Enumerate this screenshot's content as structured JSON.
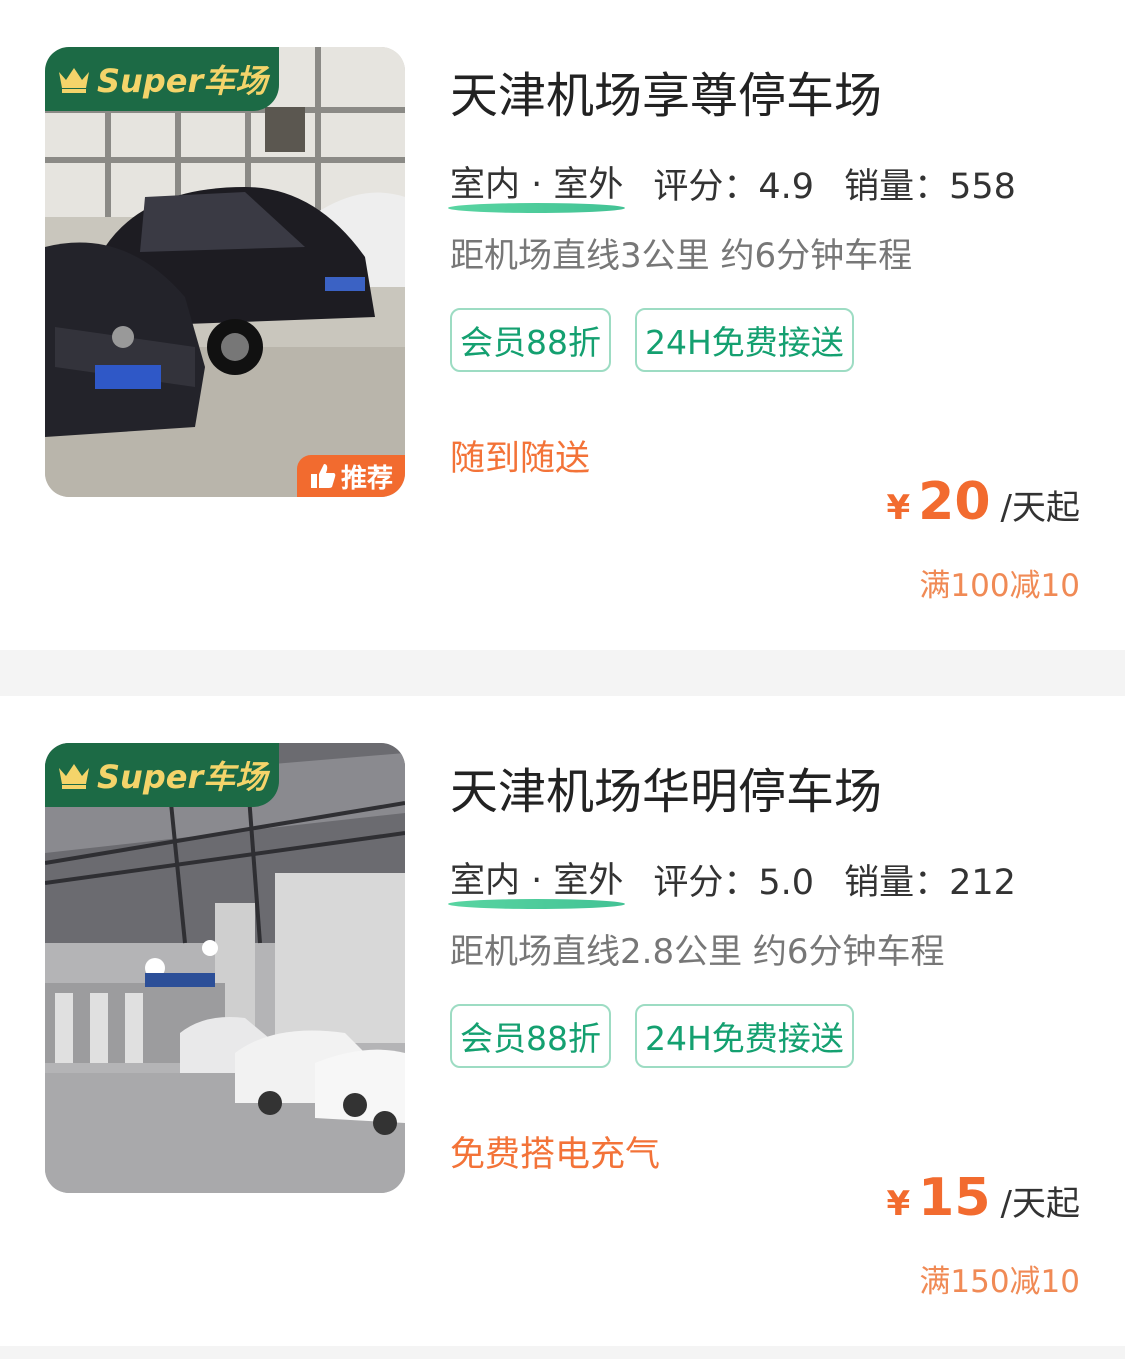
{
  "lots": [
    {
      "super_badge": "Super车场",
      "recommend_badge": "推荐",
      "name": "天津机场享尊停车场",
      "environment": "室内 · 室外",
      "rating": "评分：4.9",
      "sales": "销量：558",
      "distance": "距机场直线3公里 约6分钟车程",
      "tags": [
        "会员88折",
        "24H免费接送"
      ],
      "service": "随到随送",
      "currency": "¥",
      "price": "20",
      "price_unit": "/天起",
      "discount": "满100减10"
    },
    {
      "super_badge": "Super车场",
      "name": "天津机场华明停车场",
      "environment": "室内 · 室外",
      "rating": "评分：5.0",
      "sales": "销量：212",
      "distance": "距机场直线2.8公里 约6分钟车程",
      "tags": [
        "会员88折",
        "24H免费接送"
      ],
      "service": "免费搭电充气",
      "currency": "¥",
      "price": "15",
      "price_unit": "/天起",
      "discount": "满150减10"
    }
  ],
  "colors": {
    "brand_green": "#1c6a45",
    "badge_gold": "#f4d46a",
    "accent_orange": "#f26b2f",
    "tag_green": "#14a070"
  },
  "icons": [
    "crown-icon",
    "thumbs-up-icon"
  ]
}
